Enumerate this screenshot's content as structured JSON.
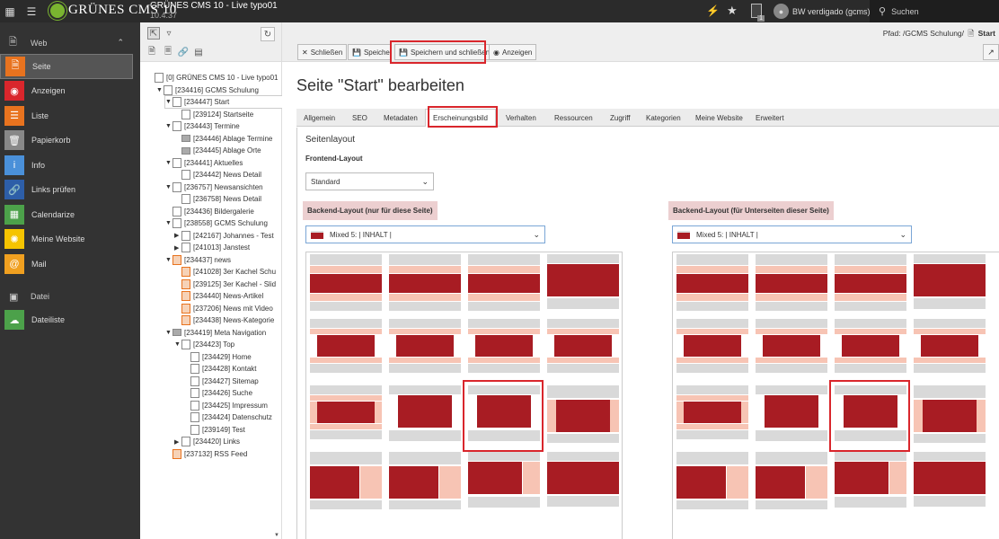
{
  "topbar": {
    "logo": "GRÜNES CMS 10",
    "site_title": "GRÜNES CMS 10 - Live typo01",
    "version": "10.4.37",
    "user": "BW verdigado (gcms)",
    "search": "Suchen",
    "notifications": "1"
  },
  "sidebar": {
    "web": "Web",
    "datei": "Datei",
    "items": [
      {
        "label": "Seite",
        "color": "#e8731f"
      },
      {
        "label": "Anzeigen",
        "color": "#d9262c"
      },
      {
        "label": "Liste",
        "color": "#e8731f"
      },
      {
        "label": "Papierkorb",
        "color": "#888888"
      },
      {
        "label": "Info",
        "color": "#4a90d9"
      },
      {
        "label": "Links prüfen",
        "color": "#2d5ea8"
      },
      {
        "label": "Calendarize",
        "color": "#4ca14a"
      },
      {
        "label": "Meine Website",
        "color": "#f5c400"
      },
      {
        "label": "Mail",
        "color": "#f0a020"
      }
    ],
    "file_items": [
      {
        "label": "Dateiliste",
        "color": "#4ca14a"
      }
    ]
  },
  "tree": [
    {
      "label": "[0] GRÜNES CMS 10 - Live typo01",
      "indent": 0
    },
    {
      "label": "[234416] GCMS Schulung",
      "indent": 1
    },
    {
      "label": "[234447] Start",
      "indent": 2
    },
    {
      "label": "[239124] Startseite",
      "indent": 3
    },
    {
      "label": "[234443] Termine",
      "indent": 2
    },
    {
      "label": "[234446] Ablage Termine",
      "indent": 3
    },
    {
      "label": "[234445] Ablage Orte",
      "indent": 3
    },
    {
      "label": "[234441] Aktuelles",
      "indent": 2
    },
    {
      "label": "[234442] News Detail",
      "indent": 3
    },
    {
      "label": "[236757] Newsansichten",
      "indent": 2
    },
    {
      "label": "[236758] News Detail",
      "indent": 3
    },
    {
      "label": "[234436] Bildergalerie",
      "indent": 2
    },
    {
      "label": "[238558] GCMS Schulung",
      "indent": 2
    },
    {
      "label": "[242167] Johannes - Test",
      "indent": 3
    },
    {
      "label": "[241013] Janstest",
      "indent": 3
    },
    {
      "label": "[234437] news",
      "indent": 2
    },
    {
      "label": "[241028] 3er Kachel Schu",
      "indent": 3
    },
    {
      "label": "[239125] 3er Kachel - Slid",
      "indent": 3
    },
    {
      "label": "[234440] News-Artikel",
      "indent": 3
    },
    {
      "label": "[237206] News mit Video",
      "indent": 3
    },
    {
      "label": "[234438] News-Kategorie",
      "indent": 3
    },
    {
      "label": "[234419] Meta Navigation",
      "indent": 2
    },
    {
      "label": "[234423] Top",
      "indent": 3
    },
    {
      "label": "[234429] Home",
      "indent": 4
    },
    {
      "label": "[234428] Kontakt",
      "indent": 4
    },
    {
      "label": "[234427] Sitemap",
      "indent": 4
    },
    {
      "label": "[234426] Suche",
      "indent": 4
    },
    {
      "label": "[234425] Impressum",
      "indent": 4
    },
    {
      "label": "[234424] Datenschutz",
      "indent": 4
    },
    {
      "label": "[239149] Test",
      "indent": 4
    },
    {
      "label": "[234420] Links",
      "indent": 3
    },
    {
      "label": "[237132] RSS Feed",
      "indent": 2
    }
  ],
  "docbar": {
    "close": "Schließen",
    "save": "Speichern",
    "save_close": "Speichern und schließen",
    "view": "Anzeigen",
    "path": "Pfad: /GCMS Schulung/",
    "path_page": "Start"
  },
  "page": {
    "title": "Seite \"Start\" bearbeiten",
    "tabs": [
      "Allgemein",
      "SEO",
      "Metadaten",
      "Erscheinungsbild",
      "Verhalten",
      "Ressourcen",
      "Zugriff",
      "Kategorien",
      "Meine Website",
      "Erweitert"
    ],
    "section_title": "Seitenlayout",
    "frontend_label": "Frontend-Layout",
    "frontend_value": "Standard",
    "backend_label": "Backend-Layout (nur für diese Seite)",
    "backend_value": "Mixed 5: | INHALT |",
    "backend_sub_label": "Backend-Layout (für Unterseiten dieser Seite)",
    "backend_sub_value": "Mixed 5: | INHALT |"
  }
}
